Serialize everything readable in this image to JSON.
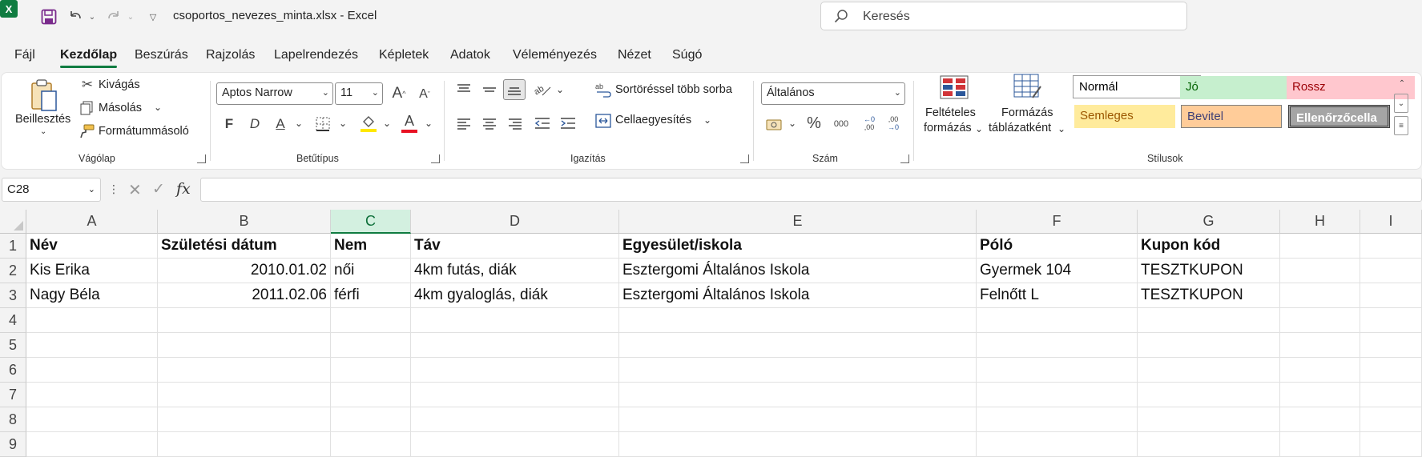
{
  "titlebar": {
    "app_logo": "X",
    "document_title": "csoportos_nevezes_minta.xlsx  -  Excel",
    "search_placeholder": "Keresés",
    "icons": [
      "excel-logo",
      "save-icon",
      "undo-icon",
      "redo-icon",
      "customize-qat-icon",
      "search-icon"
    ]
  },
  "menu": {
    "tabs": [
      "Fájl",
      "Kezdőlap",
      "Beszúrás",
      "Rajzolás",
      "Lapelrendezés",
      "Képletek",
      "Adatok",
      "Véleményezés",
      "Nézet",
      "Súgó"
    ],
    "active": "Kezdőlap"
  },
  "ribbon": {
    "clipboard": {
      "label": "Vágólap",
      "paste": "Beillesztés",
      "cut": "Kivágás",
      "copy": "Másolás",
      "format_painter": "Formátummásoló"
    },
    "font": {
      "label": "Betűtípus",
      "font_name": "Aptos Narrow",
      "font_size": "11",
      "grow": "A",
      "shrink": "A",
      "bold": "F",
      "italic": "D",
      "underline": "A",
      "font_color_letter": "A",
      "fill_color": "#ffe800",
      "font_color": "#e81123"
    },
    "alignment": {
      "label": "Igazítás",
      "wrap_text": "Sortöréssel több sorba",
      "merge": "Cellaegyesítés"
    },
    "number": {
      "label": "Szám",
      "format": "Általános",
      "percent": "%",
      "thousands": "000",
      "inc_decimal": ",00",
      "dec_decimal": ",00"
    },
    "styles": {
      "label": "Stílusok",
      "conditional_formatting": [
        "Feltételes",
        "formázás"
      ],
      "format_as_table": [
        "Formázás",
        "táblázatként"
      ],
      "cells": [
        {
          "name": "Normál",
          "bg": "#ffffff",
          "fg": "#000000",
          "border": "#9b9b9b"
        },
        {
          "name": "Jó",
          "bg": "#c6efce",
          "fg": "#006100",
          "border": "#c6efce"
        },
        {
          "name": "Rossz",
          "bg": "#ffc7ce",
          "fg": "#9c0006",
          "border": "#ffc7ce"
        },
        {
          "name": "Semleges",
          "bg": "#ffeb9c",
          "fg": "#9c5700",
          "border": "#ffeb9c"
        },
        {
          "name": "Bevitel",
          "bg": "#ffcc99",
          "fg": "#3f3f76",
          "border": "#7f7f7f"
        },
        {
          "name": "Ellenőrzőcella",
          "bg": "#a5a5a5",
          "fg": "#ffffff",
          "border": "#3f3f3f"
        }
      ]
    }
  },
  "formula_bar": {
    "name_box": "C28",
    "fx": "fx",
    "formula": ""
  },
  "sheet": {
    "columns": [
      "A",
      "B",
      "C",
      "D",
      "E",
      "F",
      "G",
      "H",
      "I"
    ],
    "selected_column": "C",
    "row_numbers": [
      "1",
      "2",
      "3",
      "4",
      "5",
      "6",
      "7",
      "8",
      "9"
    ],
    "rows": [
      [
        "Név",
        "Születési dátum",
        "Nem",
        "Táv",
        "Egyesület/iskola",
        "Póló",
        "Kupon kód",
        "",
        ""
      ],
      [
        "Kis Erika",
        "2010.01.02",
        "női",
        "4km futás, diák",
        "Esztergomi Általános Iskola",
        "Gyermek 104",
        "TESZTKUPON",
        "",
        ""
      ],
      [
        "Nagy Béla",
        "2011.02.06",
        "férfi",
        "4km gyaloglás, diák",
        "Esztergomi Általános Iskola",
        "Felnőtt L",
        "TESZTKUPON",
        "",
        ""
      ],
      [
        "",
        "",
        "",
        "",
        "",
        "",
        "",
        "",
        ""
      ],
      [
        "",
        "",
        "",
        "",
        "",
        "",
        "",
        "",
        ""
      ],
      [
        "",
        "",
        "",
        "",
        "",
        "",
        "",
        "",
        ""
      ],
      [
        "",
        "",
        "",
        "",
        "",
        "",
        "",
        "",
        ""
      ],
      [
        "",
        "",
        "",
        "",
        "",
        "",
        "",
        "",
        ""
      ],
      [
        "",
        "",
        "",
        "",
        "",
        "",
        "",
        "",
        ""
      ]
    ]
  }
}
